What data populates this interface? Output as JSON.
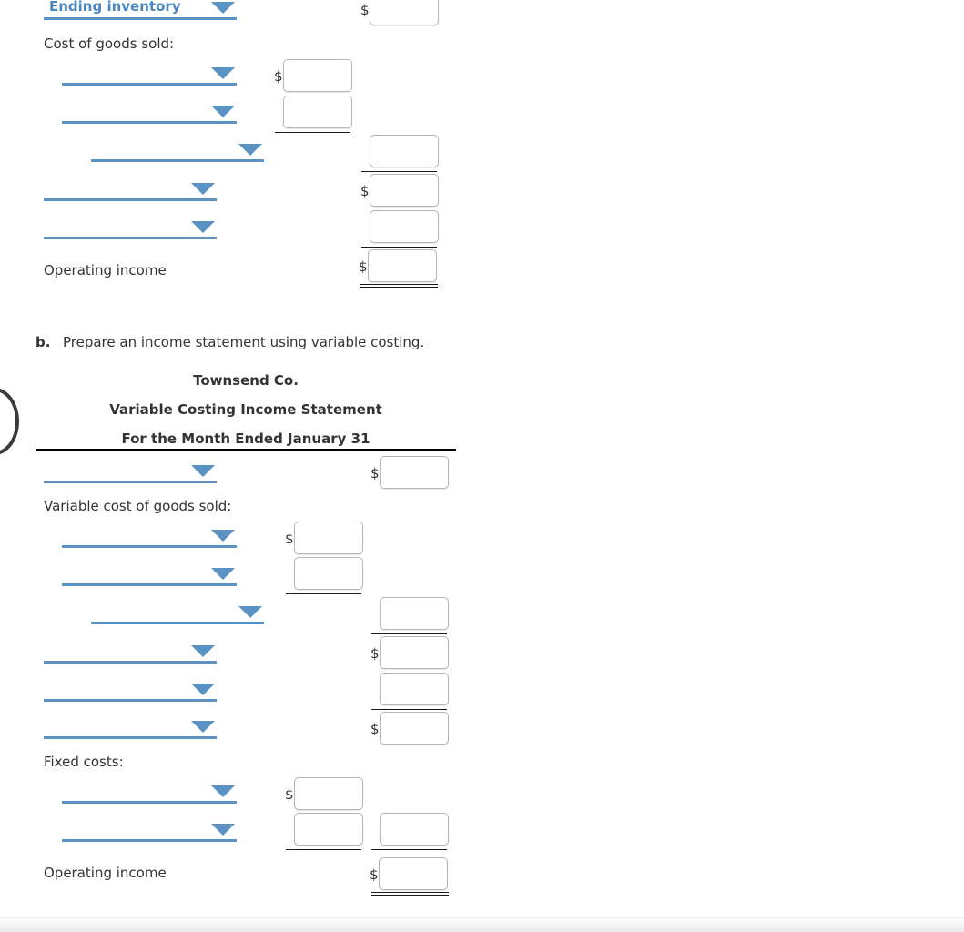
{
  "colors": {
    "select_blue": "#5b92c4",
    "select_text_blue": "#4a86c0",
    "text": "#333333",
    "rule": "#1a1a1a"
  },
  "part_a": {
    "rows": [
      {
        "type": "select",
        "name": "ending-inventory-select",
        "value": "Ending inventory"
      },
      {
        "type": "label",
        "name": "cost-of-goods-sold-label",
        "text": "Cost of goods sold:"
      },
      {
        "type": "select",
        "name": "cogs-line-1-select",
        "value": ""
      },
      {
        "type": "select",
        "name": "cogs-line-2-select",
        "value": ""
      },
      {
        "type": "select",
        "name": "cogs-line-3-select",
        "value": ""
      },
      {
        "type": "select",
        "name": "cogs-line-4-select",
        "value": ""
      },
      {
        "type": "select",
        "name": "cogs-line-5-select",
        "value": ""
      },
      {
        "type": "label",
        "name": "operating-income-label",
        "text": "Operating income"
      }
    ],
    "inputs": {
      "ending_inventory_amount": "",
      "cogs_amount_1": "",
      "cogs_amount_2": "",
      "cogs_subtotal": "",
      "gross_profit": "",
      "expenses": "",
      "operating_income": ""
    }
  },
  "part_b": {
    "prompt_marker": "b.",
    "prompt_text": "Prepare an income statement using variable costing.",
    "statement_header": {
      "company": "Townsend Co.",
      "title": "Variable Costing Income Statement",
      "period": "For the Month Ended January 31"
    },
    "rows": [
      {
        "type": "select",
        "name": "sales-select",
        "value": ""
      },
      {
        "type": "label",
        "name": "variable-cogs-label",
        "text": "Variable cost of goods sold:"
      },
      {
        "type": "select",
        "name": "variable-cogs-line-1-select",
        "value": ""
      },
      {
        "type": "select",
        "name": "variable-cogs-line-2-select",
        "value": ""
      },
      {
        "type": "select",
        "name": "variable-cogs-line-3-select",
        "value": ""
      },
      {
        "type": "select",
        "name": "variable-cogs-line-4-select",
        "value": ""
      },
      {
        "type": "select",
        "name": "variable-cogs-line-5-select",
        "value": ""
      },
      {
        "type": "select",
        "name": "variable-cogs-line-6-select",
        "value": ""
      },
      {
        "type": "label",
        "name": "fixed-costs-label",
        "text": "Fixed costs:"
      },
      {
        "type": "select",
        "name": "fixed-cost-line-1-select",
        "value": ""
      },
      {
        "type": "select",
        "name": "fixed-cost-line-2-select",
        "value": ""
      },
      {
        "type": "label",
        "name": "operating-income-label",
        "text": "Operating income"
      }
    ],
    "inputs": {
      "sales_amount": "",
      "variable_cogs_amount_1": "",
      "variable_cogs_amount_2": "",
      "variable_cogs_subtotal": "",
      "manufacturing_margin": "",
      "variable_selling_admin": "",
      "contribution_margin": "",
      "fixed_cost_amount_1": "",
      "fixed_cost_amount_2": "",
      "fixed_cost_subtotal": "",
      "operating_income": ""
    }
  },
  "currency_symbol": "$",
  "input_placeholder": ""
}
